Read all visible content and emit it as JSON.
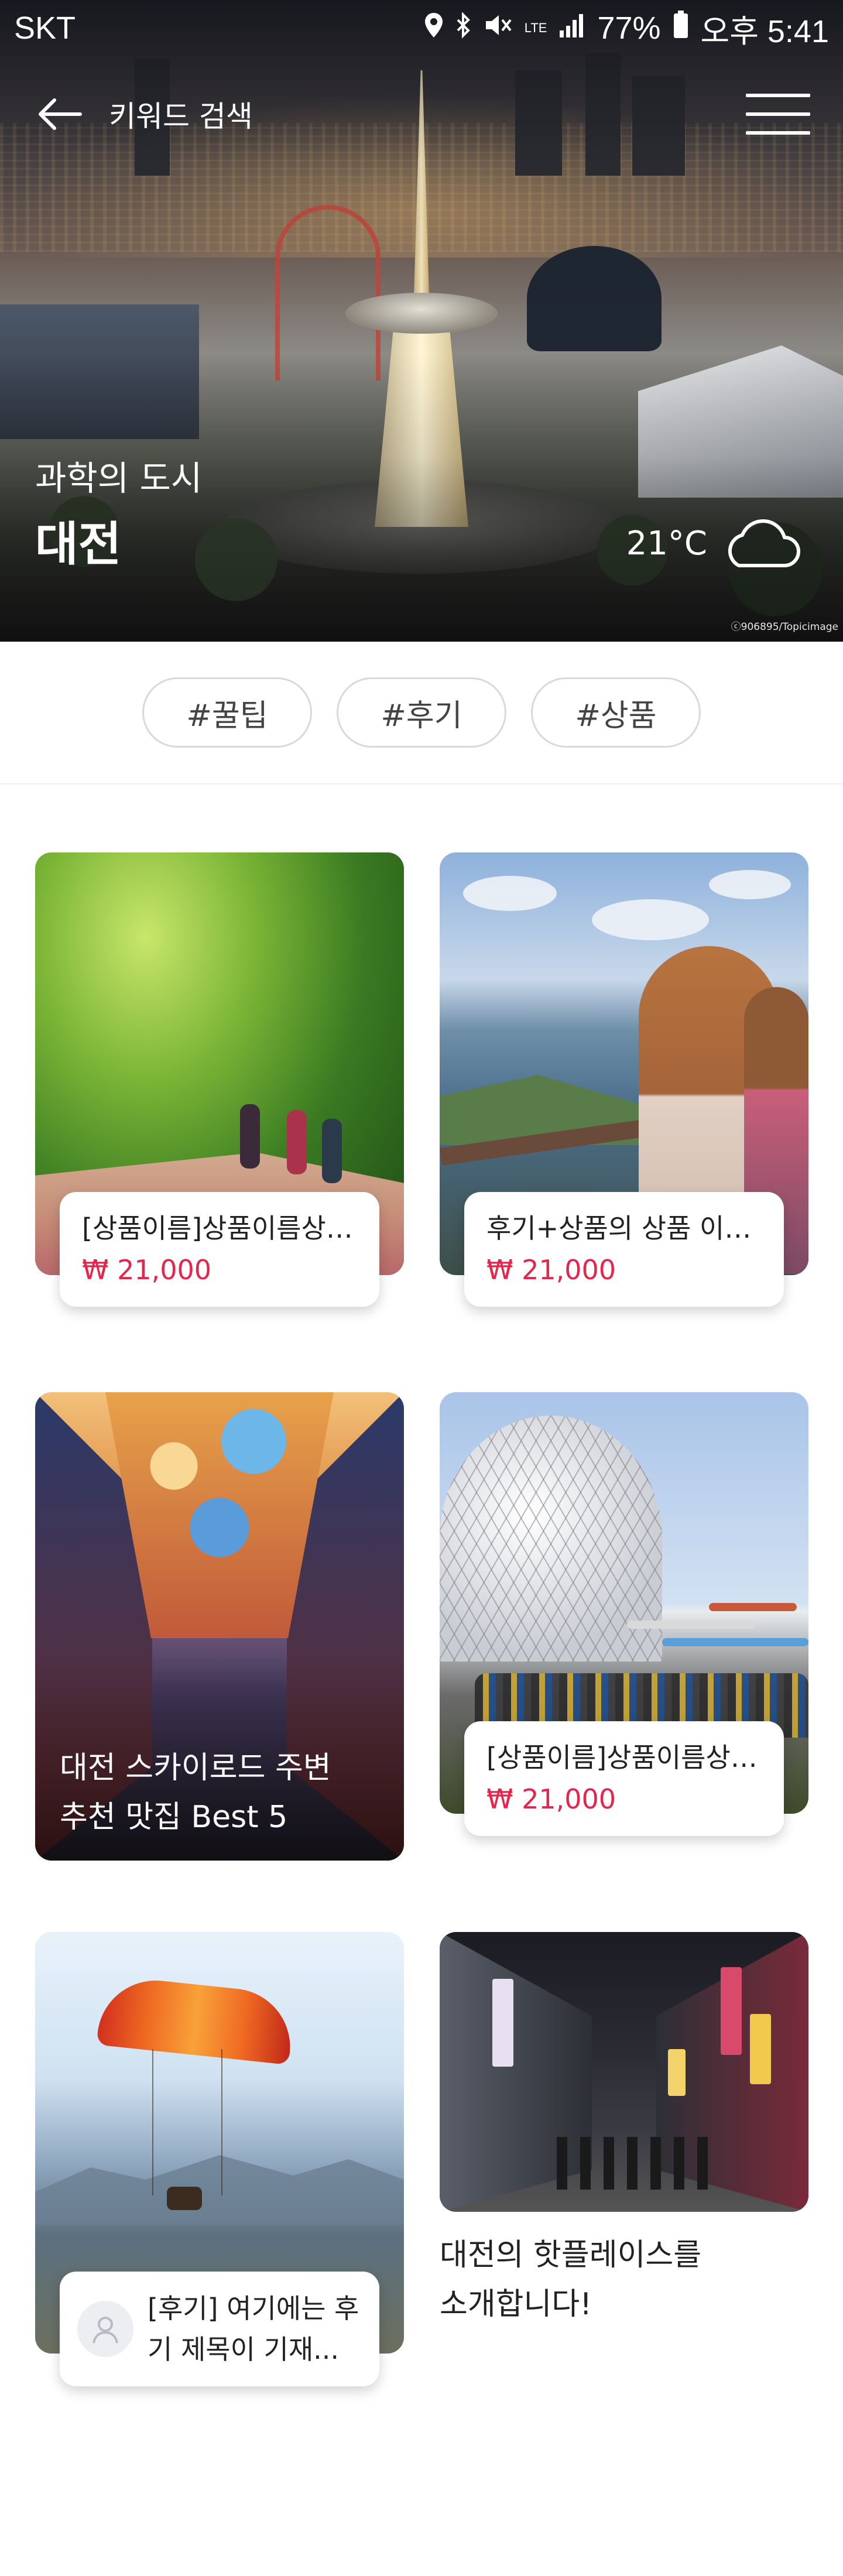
{
  "status_bar": {
    "carrier": "SKT",
    "battery": "77%",
    "time": "오후 5:41",
    "network": "LTE",
    "icons": [
      "location-icon",
      "bluetooth-icon",
      "mute-icon",
      "lte-icon",
      "signal-icon",
      "battery-icon"
    ]
  },
  "nav": {
    "title": "키워드 검색",
    "back_icon": "arrow-left-icon",
    "menu_icon": "hamburger-icon"
  },
  "hero": {
    "subtitle": "과학의 도시",
    "city": "대전",
    "temperature": "21°C",
    "weather_icon": "cloud-icon",
    "photo_credit": "ⓒ906895/Topicimage"
  },
  "tags": [
    "#꿀팁",
    "#후기",
    "#상품"
  ],
  "cards": {
    "c1": {
      "name": "[상품이름]상품이름상품이름",
      "price": "₩ 21,000"
    },
    "c2": {
      "name": "후기+상품의 상품 이름입니다",
      "price": "₩ 21,000"
    },
    "c3": {
      "line1": "대전 스카이로드 주변",
      "line2": "추천 맛집 Best 5"
    },
    "c4": {
      "name": "[상품이름]상품이름상품이름",
      "price": "₩ 21,000"
    },
    "c5": {
      "line1": "[후기] 여기에는 후",
      "line2": "기 제목이 기재...",
      "avatar_icon": "user-icon"
    },
    "c6": {
      "line1": "대전의 핫플레이스를",
      "line2": "소개합니다!"
    }
  },
  "colors": {
    "accent_price": "#e8244d",
    "tag_border": "#d9d9d9"
  }
}
